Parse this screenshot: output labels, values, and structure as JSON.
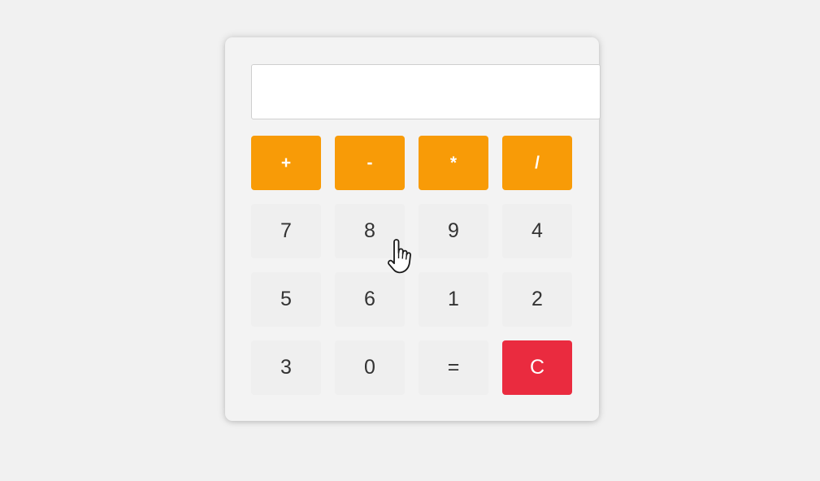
{
  "calculator": {
    "display_value": "",
    "operator_keys": [
      "+",
      "-",
      "*",
      "/"
    ],
    "rows": [
      [
        "7",
        "8",
        "9",
        "4"
      ],
      [
        "5",
        "6",
        "1",
        "2"
      ],
      [
        "3",
        "0",
        "=",
        "C"
      ]
    ]
  },
  "colors": {
    "operator": "#f89b07",
    "clear": "#ea2b3f",
    "key": "#efefef",
    "panel": "#f3f3f3"
  },
  "cursor": {
    "icon": "hand-pointer-icon"
  }
}
